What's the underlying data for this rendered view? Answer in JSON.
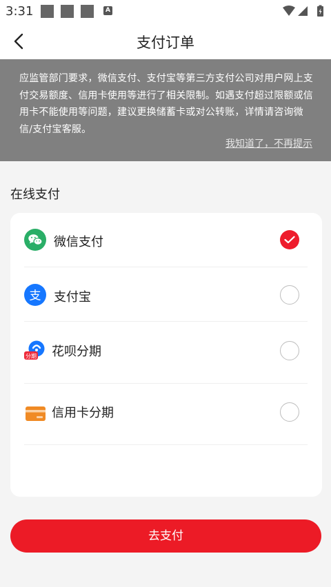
{
  "status_bar": {
    "time": "3:31"
  },
  "nav": {
    "title": "支付订单"
  },
  "notice": {
    "text": "应监管部门要求，微信支付、支付宝等第三方支付公司对用户网上支付交易额度、信用卡使用等进行了相关限制。如遇支付超过限额或信用卡不能使用等问题，建议更换储蓄卡或对公转账，详情请咨询微信/支付宝客服。",
    "dismiss_label": "我知道了，不再提示"
  },
  "section_title": "在线支付",
  "payment_options": [
    {
      "label": "微信支付",
      "icon": "wechat-pay-icon",
      "selected": true
    },
    {
      "label": "支付宝",
      "icon": "alipay-icon",
      "selected": false
    },
    {
      "label": "花呗分期",
      "icon": "huabei-icon",
      "selected": false,
      "badge": "分期"
    },
    {
      "label": "信用卡分期",
      "icon": "credit-card-icon",
      "selected": false
    }
  ],
  "pay_button": {
    "label": "去支付"
  },
  "colors": {
    "accent": "#ec1b26",
    "notice_bg": "#808080",
    "wechat": "#2aae67",
    "alipay": "#1677ff",
    "card_orange": "#f08a24"
  }
}
